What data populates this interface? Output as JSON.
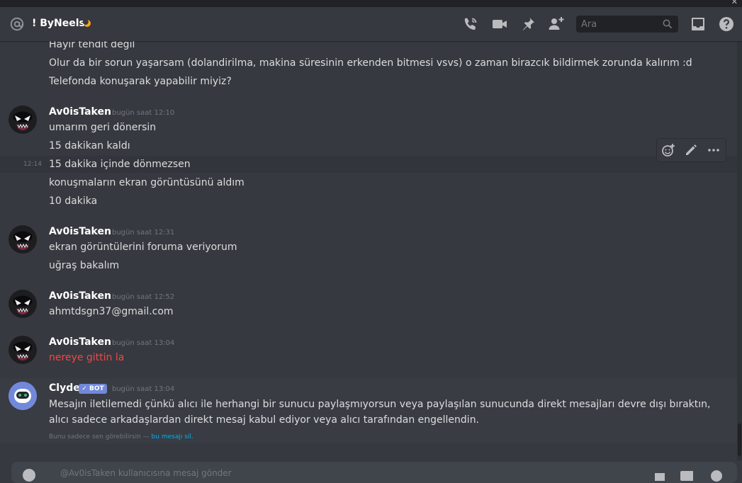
{
  "header": {
    "channel_name": "! ByNeels",
    "search_placeholder": "Ara",
    "icons": [
      "at-icon",
      "moon-icon",
      "call-icon",
      "video-icon",
      "pin-icon",
      "add-friend-icon",
      "search-icon",
      "inbox-icon",
      "help-icon"
    ]
  },
  "messages": {
    "top_lines": [
      "Hayır tehdit değil",
      "Olur da bir sorun yaşarsam (dolandirilma, makina süresinin erkenden bitmesi vsvs) o zaman birazcık bildirmek zorunda kalırım :d",
      "Telefonda konuşarak yapabilir miyiz?"
    ],
    "groups": [
      {
        "author": "Av0isTaken",
        "timestamp": "bugün saat 12:10",
        "lines": [
          "umarım geri dönersin",
          "15 dakikan kaldı",
          "15 dakika içinde dönmezsen",
          "konuşmaların ekran görüntüsünü aldım",
          "10 dakika"
        ],
        "inline_timestamp": "12:14"
      },
      {
        "author": "Av0isTaken",
        "timestamp": "bugün saat 12:31",
        "lines": [
          "ekran görüntülerini foruma veriyorum",
          "uğraş bakalım"
        ]
      },
      {
        "author": "Av0isTaken",
        "timestamp": "bugün saat 12:52",
        "lines": [
          "ahmtdsgn37@gmail.com"
        ]
      },
      {
        "author": "Av0isTaken",
        "timestamp": "bugün saat 13:04",
        "lines": [
          "nereye gittin la"
        ]
      }
    ],
    "clyde": {
      "author": "Clyde",
      "badge": "BOT",
      "timestamp": "bugün saat 13:04",
      "text": "Mesajın iletilemedi çünkü alıcı ile herhangi bir sunucu paylaşmıyorsun veya paylaşılan sunucunda direkt mesajları devre dışı bıraktın, alıcı sadece arkadaşlardan direkt mesaj kabul ediyor veya alıcı tarafından engellendin.",
      "notice": "Bunu sadece sen görebilirsin —",
      "notice_link": "bu mesajı sil."
    }
  },
  "message_actions": {
    "icons": [
      "add-reaction-icon",
      "edit-icon",
      "more-icon"
    ]
  },
  "composer": {
    "placeholder": "@Av0isTaken kullanıcısına mesaj gönder"
  },
  "colors": {
    "background": "#36393f",
    "header_text": "#ffffff",
    "message_text": "#dcddde",
    "timestamp": "#72767d",
    "red_text": "#f04747",
    "bot_badge": "#7289da",
    "link": "#00b0f4",
    "search_bg": "#202225"
  }
}
